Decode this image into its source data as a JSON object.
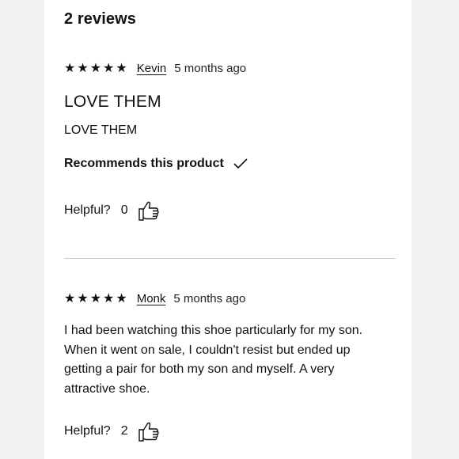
{
  "reviews_header": {
    "count_label": "2 reviews"
  },
  "reviews": [
    {
      "stars": "★★★★★",
      "author": "Kevin",
      "time": "5 months ago",
      "title": "LOVE THEM",
      "body": "LOVE THEM",
      "recommends_label": "Recommends this product",
      "helpful_label": "Helpful?",
      "helpful_count": "0",
      "rating": 5
    },
    {
      "stars": "★★★★★",
      "author": "Monk",
      "time": "5 months ago",
      "body": "I had been watching this shoe particularly for my son. When it went on sale, I couldn't resist but ended up getting a pair for both my son and myself. A very attractive shoe.",
      "helpful_label": "Helpful?",
      "helpful_count": "2",
      "rating": 5
    }
  ],
  "icons": {
    "check": "check-icon",
    "thumb": "thumbs-up-icon"
  }
}
